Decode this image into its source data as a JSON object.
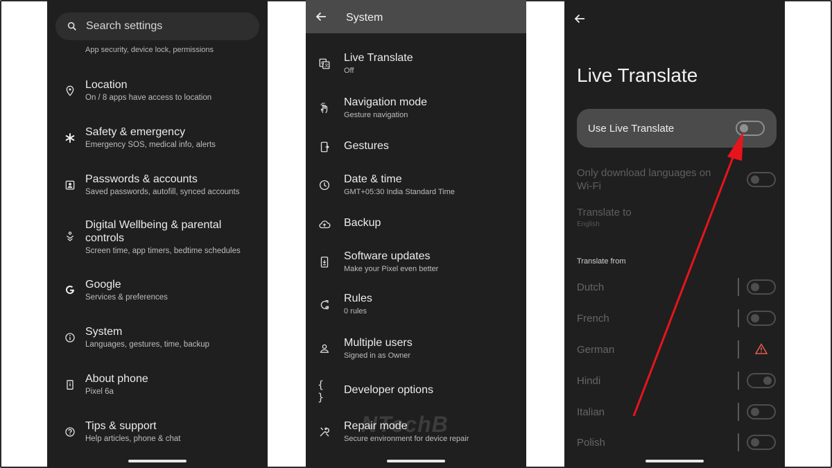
{
  "panel1": {
    "search": {
      "placeholder": "Search settings",
      "icon": "search-icon"
    },
    "peek_text": "App security, device lock, permissions",
    "items": [
      {
        "title": "Location",
        "subtitle": "On / 8 apps have access to location",
        "icon": "location-pin-icon"
      },
      {
        "title": "Safety & emergency",
        "subtitle": "Emergency SOS, medical info, alerts",
        "icon": "asterisk-icon"
      },
      {
        "title": "Passwords & accounts",
        "subtitle": "Saved passwords, autofill, synced accounts",
        "icon": "account-box-icon"
      },
      {
        "title": "Digital Wellbeing & parental controls",
        "subtitle": "Screen time, app timers, bedtime schedules",
        "icon": "wellbeing-icon"
      },
      {
        "title": "Google",
        "subtitle": "Services & preferences",
        "icon": "google-icon"
      },
      {
        "title": "System",
        "subtitle": "Languages, gestures, time, backup",
        "icon": "info-icon"
      },
      {
        "title": "About phone",
        "subtitle": "Pixel 6a",
        "icon": "phone-icon"
      },
      {
        "title": "Tips & support",
        "subtitle": "Help articles, phone & chat",
        "icon": "help-icon"
      }
    ]
  },
  "panel2": {
    "title": "System",
    "items": [
      {
        "title": "Live Translate",
        "subtitle": "Off",
        "icon": "translate-icon"
      },
      {
        "title": "Navigation mode",
        "subtitle": "Gesture navigation",
        "icon": "gesture-hand-icon"
      },
      {
        "title": "Gestures",
        "subtitle": "",
        "icon": "phone-gesture-icon"
      },
      {
        "title": "Date & time",
        "subtitle": "GMT+05:30 India Standard Time",
        "icon": "clock-icon"
      },
      {
        "title": "Backup",
        "subtitle": "",
        "icon": "cloud-upload-icon"
      },
      {
        "title": "Software updates",
        "subtitle": "Make your Pixel even better",
        "icon": "system-update-icon"
      },
      {
        "title": "Rules",
        "subtitle": "0 rules",
        "icon": "rules-icon"
      },
      {
        "title": "Multiple users",
        "subtitle": "Signed in as Owner",
        "icon": "person-icon"
      },
      {
        "title": "Developer options",
        "subtitle": "",
        "icon": "braces-icon"
      },
      {
        "title": "Repair mode",
        "subtitle": "Secure environment for device repair",
        "icon": "tools-icon"
      }
    ],
    "watermark": "NTechB"
  },
  "panel3": {
    "title": "Live Translate",
    "use_live_translate": {
      "label": "Use Live Translate",
      "enabled": false
    },
    "wifi_only": {
      "label": "Only download languages on Wi-Fi"
    },
    "translate_to": {
      "label": "Translate to",
      "value": "English"
    },
    "section_label": "Translate from",
    "languages": [
      {
        "name": "Dutch",
        "control": "toggle"
      },
      {
        "name": "French",
        "control": "toggle"
      },
      {
        "name": "German",
        "control": "warning"
      },
      {
        "name": "Hindi",
        "control": "toggle"
      },
      {
        "name": "Italian",
        "control": "toggle"
      },
      {
        "name": "Polish",
        "control": "toggle"
      }
    ]
  },
  "colors": {
    "arrow": "#e8141c",
    "panel_bg": "#1f1f1f",
    "card_bg": "#4b4b4b",
    "warning": "#e05a4f"
  }
}
